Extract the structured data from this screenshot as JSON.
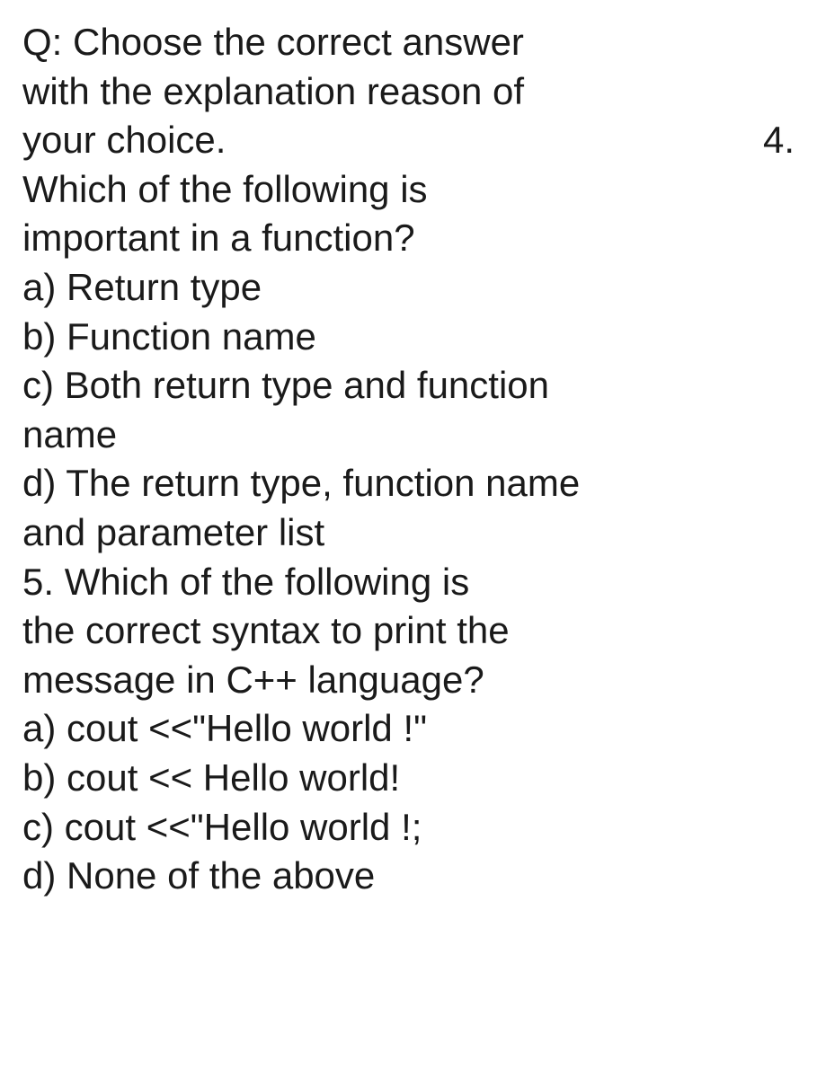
{
  "intro": {
    "line1": "Q: Choose the correct answer",
    "line2": "with the explanation reason of",
    "line3_left": "your choice.",
    "line3_right": "4."
  },
  "q4": {
    "line1": "Which of the following is",
    "line2": "important in a function?",
    "a": "a) Return type",
    "b": "b) Function name",
    "c_line1": "c) Both return type and function",
    "c_line2": "name",
    "d_line1": "d) The return type, function name",
    "d_line2": "and parameter list"
  },
  "q5": {
    "line1": "5. Which of the following is",
    "line2": "the correct syntax to print the",
    "line3": "message in C++ language?",
    "a": "a) cout <<\"Hello world !\"",
    "b": "b) cout << Hello world!",
    "c": "c) cout <<\"Hello world !;",
    "d": "d) None of the above"
  }
}
